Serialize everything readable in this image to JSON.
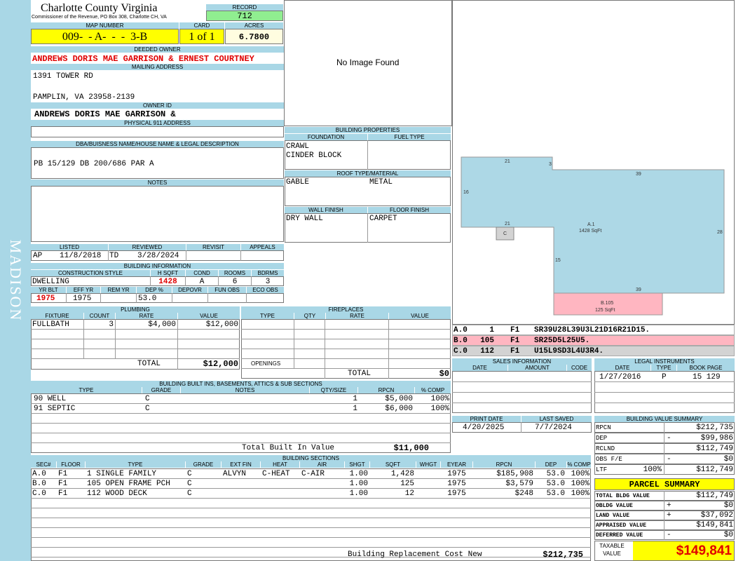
{
  "side_label": "MADISON",
  "county": {
    "name": "Charlotte County Virginia",
    "subtitle": "Commissioner of the Revenue, PO Box 308, Charlotte CH, VA"
  },
  "record": {
    "label": "RECORD",
    "value": "712"
  },
  "map_number": {
    "label": "MAP NUMBER",
    "value": "009-  - A-  -  -  3-B"
  },
  "card": {
    "label": "CARD",
    "value": "1 of 1"
  },
  "acres": {
    "label": "ACRES",
    "value": "6.7800"
  },
  "deeded_owner": {
    "label": "DEEDED OWNER",
    "value": "ANDREWS DORIS MAE GARRISON & ERNEST COURTNEY"
  },
  "mailing_address": {
    "label": "MAILING ADDRESS",
    "line1": "1391 TOWER RD",
    "line2": "PAMPLIN, VA 23958-2139"
  },
  "owner_id": {
    "label": "OWNER ID",
    "value": "ANDREWS DORIS MAE GARRISON &"
  },
  "physical_address": {
    "label": "PHYSICAL 911 ADDRESS",
    "value": ""
  },
  "dba": {
    "label": "DBA/BUISNESS NAME/HOUSE NAME & LEGAL DESCRIPTION",
    "value": "PB 15/129 DB 200/686 PAR A"
  },
  "notes": {
    "label": "NOTES",
    "value": ""
  },
  "photo": {
    "text": "No Image Found"
  },
  "building_properties": {
    "label": "BUILDING PROPERTIES",
    "foundation_label": "FOUNDATION",
    "foundation1": "CRAWL",
    "foundation2": "CINDER BLOCK",
    "fuel_label": "FUEL TYPE",
    "fuel": "",
    "roof_label": "ROOF TYPE/MATERIAL",
    "roof_type": "GABLE",
    "roof_material": "METAL",
    "wall_label": "WALL FINISH",
    "wall": "DRY WALL",
    "floor_label": "FLOOR FINISH",
    "floor": "CARPET"
  },
  "status": {
    "listed_label": "LISTED",
    "listed_code": "AP",
    "listed_date": "11/8/2018",
    "reviewed_label": "REVIEWED",
    "reviewed_code": "TD",
    "reviewed_date": "3/28/2024",
    "revisit_label": "REVISIT",
    "appeals_label": "APPEALS"
  },
  "building_info": {
    "label": "BUILDING INFORMATION",
    "cs_label": "CONSTRUCTION STYLE",
    "cs": "DWELLING",
    "hsqft_label": "H SQFT",
    "hsqft": "1428",
    "cond_label": "COND",
    "cond": "A",
    "rooms_label": "ROOMS",
    "rooms": "6",
    "bdrms_label": "BDRMS",
    "bdrms": "3",
    "yrblt_label": "YR BLT",
    "yrblt": "1975",
    "effyr_label": "EFF YR",
    "effyr": "1975",
    "remyr_label": "REM YR",
    "remyr": "",
    "deppct_label": "DEP %",
    "deppct": "53.0",
    "depovr_label": "DEPOVR",
    "depovr": "",
    "funobs_label": "FUN OBS",
    "funobs": "",
    "ecoobs_label": "ECO OBS",
    "ecoobs": ""
  },
  "plumbing": {
    "label": "PLUMBING",
    "headers": [
      "FIXTURE",
      "COUNT",
      "RATE",
      "VALUE"
    ],
    "rows": [
      [
        "FULLBATH",
        "3",
        "$4,000",
        "$12,000"
      ]
    ],
    "total_label": "TOTAL",
    "total": "$12,000"
  },
  "fireplaces": {
    "label": "FIREPLACES",
    "headers": [
      "TYPE",
      "QTY",
      "RATE",
      "VALUE"
    ],
    "openings_label": "OPENINGS",
    "total_label": "TOTAL",
    "total": "$0"
  },
  "builtins": {
    "label": "BUILDING BUILT INS, BASEMENTS, ATTICS & SUB SECTIONS",
    "headers": [
      "TYPE",
      "GRADE",
      "NOTES",
      "QTY/SIZE",
      "RPCN",
      "% COMP"
    ],
    "rows": [
      [
        "90 WELL",
        "C",
        "",
        "1",
        "$5,000",
        "100%"
      ],
      [
        "91 SEPTIC",
        "C",
        "",
        "1",
        "$6,000",
        "100%"
      ]
    ],
    "total_label": "Total Built In Value",
    "total": "$11,000"
  },
  "sections": {
    "label": "BUILDING SECTIONS",
    "headers": [
      "SEC#",
      "FLOOR",
      "TYPE",
      "GRADE",
      "EXT FIN",
      "HEAT",
      "AIR",
      "SHGT",
      "SQFT",
      "WHGT",
      "EYEAR",
      "RPCN",
      "DEP",
      "% COMP"
    ],
    "rows": [
      [
        "A.0",
        "F1",
        "1 SINGLE FAMILY",
        "C",
        "ALVYN",
        "C-HEAT",
        "C-AIR",
        "1.00",
        "1,428",
        "",
        "1975",
        "$185,908",
        "53.0",
        "100%"
      ],
      [
        "B.0",
        "F1",
        "105 OPEN FRAME PCH",
        "C",
        "",
        "",
        "",
        "1.00",
        "125",
        "",
        "1975",
        "$3,579",
        "53.0",
        "100%"
      ],
      [
        "C.0",
        "F1",
        "112 WOOD DECK",
        "C",
        "",
        "",
        "",
        "1.00",
        "12",
        "",
        "1975",
        "$248",
        "53.0",
        "100%"
      ]
    ],
    "total_label": "Building Replacement Cost New",
    "total": "$212,735"
  },
  "sketch": {
    "labels": {
      "top_left": "21",
      "notch": "3",
      "top_right": "39",
      "left": "16",
      "right": "28",
      "lower_left": "21",
      "lower_side": "15",
      "bottom": "39",
      "area_a": "A.1",
      "area_a_sqft": "1428 SqFt",
      "area_b": "B.105",
      "area_b_sqft": "125 SqFt",
      "area_c": "C"
    },
    "colors": {
      "main": "#add8e6",
      "porch": "#ffb6c1",
      "deck": "#d3d3d3"
    },
    "codes": [
      {
        "sec": "A.0",
        "num": "1",
        "floor": "F1",
        "code": "SR39U28L39U3L21D16R21D15."
      },
      {
        "sec": "B.0",
        "num": "105",
        "floor": "F1",
        "code": "SR25D5L25U5."
      },
      {
        "sec": "C.0",
        "num": "112",
        "floor": "F1",
        "code": "U15L9SD3L4U3R4."
      }
    ]
  },
  "sales": {
    "label": "SALES INFORMATION",
    "headers": [
      "DATE",
      "AMOUNT",
      "CODE"
    ]
  },
  "legal": {
    "label": "LEGAL INSTRUMENTS",
    "headers": [
      "DATE",
      "TYPE",
      "BOOK PAGE"
    ],
    "rows": [
      [
        "1/27/2016",
        "P",
        "15 129"
      ]
    ]
  },
  "print_date": {
    "label": "PRINT DATE",
    "value": "4/20/2025"
  },
  "last_saved": {
    "label": "LAST SAVED",
    "value": "7/7/2024"
  },
  "bvs": {
    "label": "BUILDING VALUE SUMMARY",
    "rows": [
      {
        "label": "RPCN",
        "sign": "",
        "value": "$212,735"
      },
      {
        "label": "DEP",
        "sign": "-",
        "value": "$99,986"
      },
      {
        "label": "RCLND",
        "sign": "",
        "value": "$112,749"
      },
      {
        "label": "OBS F/E",
        "sign": "-",
        "value": "$0"
      },
      {
        "label": "LTF",
        "pct": "100%",
        "sign": "",
        "value": "$112,749"
      }
    ]
  },
  "parcel": {
    "label": "PARCEL SUMMARY",
    "rows": [
      {
        "label": "TOTAL BLDG VALUE",
        "sign": "",
        "value": "$112,749"
      },
      {
        "label": "OBLDG VALUE",
        "sign": "+",
        "value": "$0"
      },
      {
        "label": "LAND VALUE",
        "sign": "+",
        "value": "$37,092"
      },
      {
        "label": "APPRAISED VALUE",
        "sign": "",
        "value": "$149,841"
      },
      {
        "label": "DEFERRED VALUE",
        "sign": "-",
        "value": "$0"
      }
    ],
    "taxable_label1": "TAXABLE",
    "taxable_label2": "VALUE",
    "taxable": "$149,841"
  }
}
